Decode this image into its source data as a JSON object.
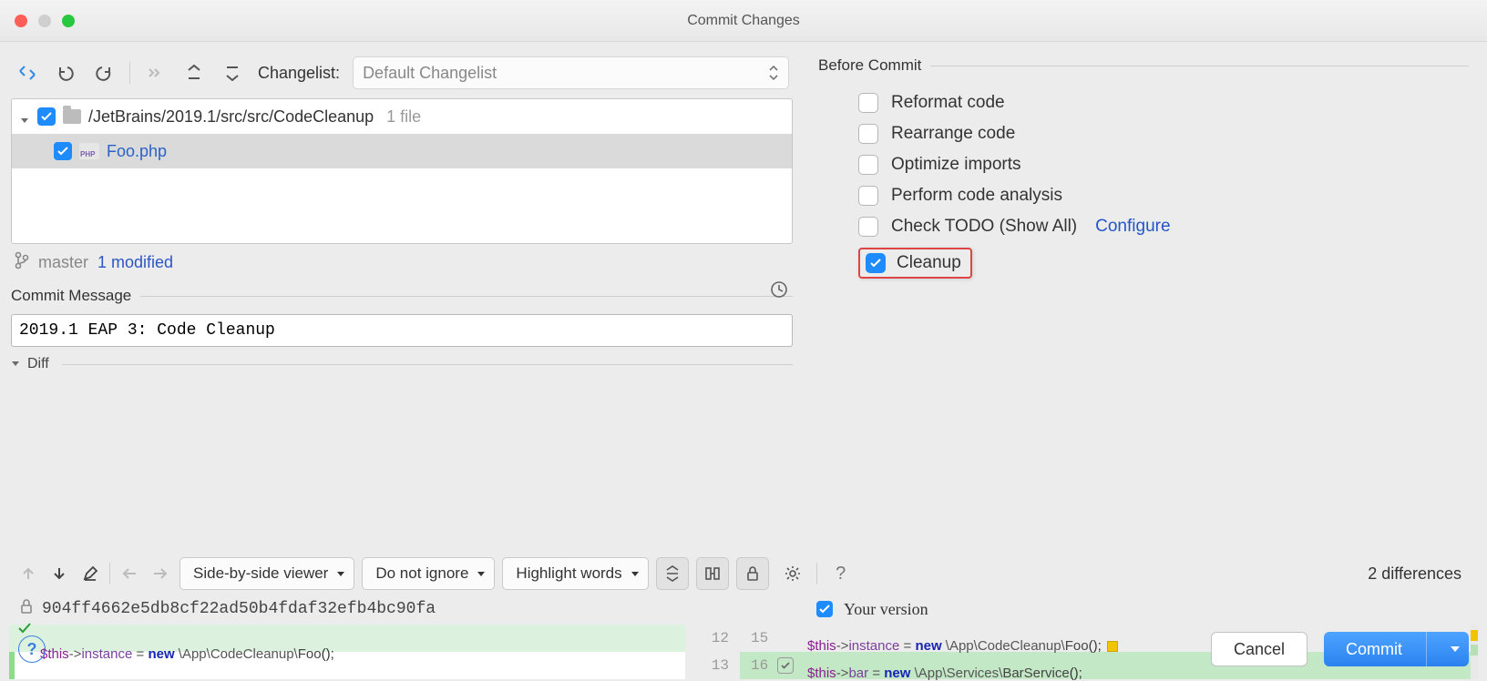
{
  "title": "Commit Changes",
  "toolbar": {
    "changelist_label": "Changelist:",
    "changelist_value": "Default Changelist"
  },
  "tree": {
    "path": "/JetBrains/2019.1/src/src/CodeCleanup",
    "file_count": "1 file",
    "file": "Foo.php"
  },
  "branch": {
    "name": "master",
    "status": "1 modified"
  },
  "commit_message": {
    "title": "Commit Message",
    "value": "2019.1 EAP 3: Code Cleanup"
  },
  "diff": {
    "title": "Diff",
    "viewer_mode": "Side-by-side viewer",
    "ignore_mode": "Do not ignore",
    "highlight_mode": "Highlight words",
    "count": "2 differences",
    "left_hash": "904ff4662e5db8cf22ad50b4fdaf32efb4bc90fa",
    "right_title": "Your version",
    "left_lines": {
      "l1_no": "12",
      "l2_no": "13"
    },
    "right_lines": {
      "l1_no": "15",
      "l2_no": "16"
    }
  },
  "before_commit": {
    "title": "Before Commit",
    "reformat": "Reformat code",
    "rearrange": "Rearrange code",
    "optimize": "Optimize imports",
    "analysis": "Perform code analysis",
    "todo": "Check TODO (Show All)",
    "todo_link": "Configure",
    "cleanup": "Cleanup"
  },
  "buttons": {
    "cancel": "Cancel",
    "commit": "Commit"
  },
  "code": {
    "left_line": "$this->instance = new \\App\\CodeCleanup\\Foo();",
    "right_line1": "$this->instance = new \\App\\CodeCleanup\\Foo();",
    "right_line2": "$this->bar = new \\App\\Services\\BarService();"
  }
}
